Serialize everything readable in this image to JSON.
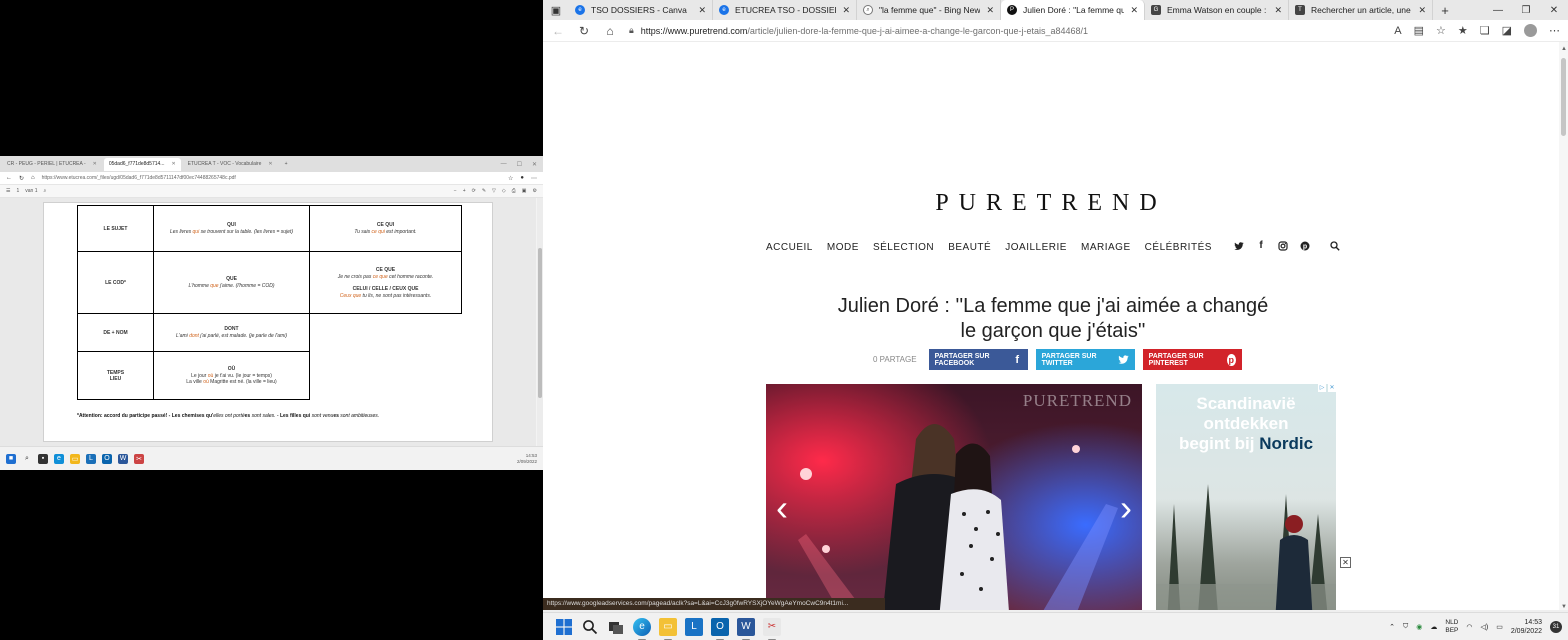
{
  "left_window": {
    "tabs": [
      {
        "label": "CR - PEUG - PERIEL | ETUCREA -"
      },
      {
        "label": "05dad6_f771de8d5714..."
      },
      {
        "label": "ETUCREA T - VOC - Vocabulaire"
      }
    ],
    "active_tab_index": 1,
    "url": "https://www.etucrea.com/_files/ugd/05dad6_f771de8d5711147df00ec74488265748c.pdf",
    "page_indicator": "1",
    "page_total": "van 1",
    "table": {
      "rows": [
        {
          "head": "LE SUJET",
          "c2_kw": "QUI",
          "c2_ex_pre": "Les livres ",
          "c2_ex_hl": "qui",
          "c2_ex_post": " se trouvent sur la table. (les livres = sujet)",
          "c3_kw": "CE QUI",
          "c3_ex_pre": "Tu sais ",
          "c3_ex_hl": "ce qui",
          "c3_ex_post": " est important."
        },
        {
          "head": "LE COD*",
          "c2_kw": "QUE",
          "c2_ex_pre": "L'homme ",
          "c2_ex_hl": "que",
          "c2_ex_post": " j'aime. (l'homme = COD)",
          "c3_kw": "CE QUE",
          "c3_ex_pre": "Je ne crois pas ",
          "c3_ex_hl": "ce que",
          "c3_ex_post": " cet homme raconte.",
          "c3_kw2": "CELUI / CELLE / CEUX QUE",
          "c3_ex2_hl": "Ceux que",
          "c3_ex2_post": " tu lis, ne sont pas intéressants."
        },
        {
          "head": "DE + NOM",
          "c2_kw": "DONT",
          "c2_ex_pre": "L'ami ",
          "c2_ex_hl": "dont",
          "c2_ex_post": " j'ai parlé, est malade. (je parle de l'ami)"
        },
        {
          "head": "TEMPS\nLIEU",
          "head_line1": "TEMPS",
          "head_line2": "LIEU",
          "c2_kw": "OÙ",
          "c2_ex_pre": "Le jour ",
          "c2_ex_hl": "où",
          "c2_ex_post": " je t'ai vu. (le jour = temps)",
          "c2_ex2_pre": "La ville ",
          "c2_ex2_hl": "où",
          "c2_ex2_post": " Magritte est né. (la ville = lieu)"
        }
      ],
      "note_bold": "*Attention: accord du participe passé! - Les chemises qu'",
      "note_mid1": "elles ont porté",
      "note_b2": "es",
      "note_mid2": " sont sales. - ",
      "note_b3": "Les filles qui",
      "note_mid3": " sont venu",
      "note_b4": "es",
      "note_end": " sont ambitieuses."
    },
    "clock_time": "14:53",
    "clock_date": "2/09/2022"
  },
  "browser": {
    "tabs": [
      {
        "label": "TSO DOSSIERS - Canva",
        "icon": "edge-icon",
        "color": "#1a73e8"
      },
      {
        "label": "ETUCREA TSO - DOSSIER ACTU",
        "icon": "edge-icon",
        "color": "#1a73e8"
      },
      {
        "label": "\"la femme que\" - Bing News",
        "icon": "search-icon",
        "color": "#555555"
      },
      {
        "label": "Julien Doré : \"La femme que j'ai",
        "icon": "puretrend-icon",
        "color": "#111111"
      },
      {
        "label": "Emma Watson en couple : qui es",
        "icon": "news-icon",
        "color": "#444444"
      },
      {
        "label": "Rechercher un article, une inform",
        "icon": "news-icon",
        "color": "#444444"
      }
    ],
    "active_tab_index": 3,
    "url_host": "https://www.puretrend.com",
    "url_path": "/article/julien-dore-la-femme-que-j-ai-aimee-a-change-le-garcon-que-j-etais_a84468/1",
    "status_url": "https://www.googleadservices.com/pagead/aclk?sa=L&ai=CcJ3g0fwRYSXjOYeWgAeYmoCwC9n4t1mi..."
  },
  "site": {
    "logo": "PURETREND",
    "nav": [
      "ACCUEIL",
      "MODE",
      "SÉLECTION",
      "BEAUTÉ",
      "JOAILLERIE",
      "MARIAGE",
      "CÉLÉBRITÉS"
    ],
    "headline_line1": "Julien Doré : ''La femme que j'ai aimée a changé",
    "headline_line2": "le garçon que j'étais''",
    "share_count": "0 PARTAGE",
    "share_facebook": "PARTAGER SUR FACEBOOK",
    "share_twitter": "PARTAGER SUR TWITTER",
    "share_pinterest": "PARTAGER SUR PINTEREST",
    "watermark": "PURETREND"
  },
  "ad": {
    "line1": "Scandinavië",
    "line2": "ontdekken",
    "line3_pre": "begint bij ",
    "line3_brand": "Nordic"
  },
  "taskbar": {
    "lang_line1": "NLD",
    "lang_line2": "BEP",
    "time": "14:53",
    "date": "2/09/2022",
    "notifications": "31"
  }
}
